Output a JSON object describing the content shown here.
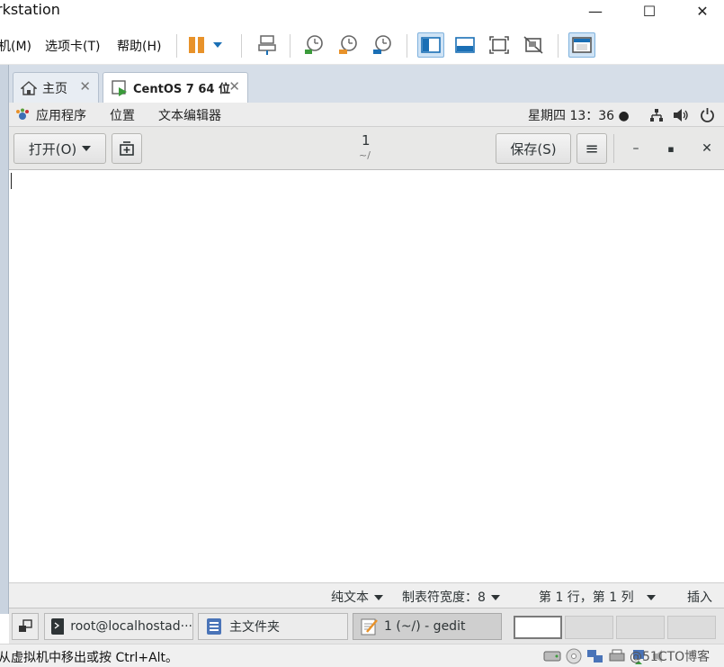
{
  "vmware": {
    "title": "rkstation",
    "menu": [
      "机(M)",
      "选项卡(T)",
      "帮助(H)"
    ],
    "window_controls": [
      "—",
      "☐",
      "✕"
    ],
    "tabs": [
      {
        "label": "主页",
        "close": "✕"
      },
      {
        "label": "CentOS 7 64 位",
        "close": "✕"
      }
    ],
    "status_message": "从虚拟机中移出或按 Ctrl+Alt。",
    "watermark": "@51CTO博客",
    "colors": {
      "accent_blue": "#1a6fb5",
      "pause_orange": "#e8922a"
    }
  },
  "gnome": {
    "applications": "应用程序",
    "places": "位置",
    "current_app": "文本编辑器",
    "clock": "星期四 13：36 ●"
  },
  "gedit": {
    "open_label": "打开(O)",
    "doc_title": "1",
    "doc_path": "~/",
    "save_label": "保存(S)",
    "menu_glyph": "≡",
    "minimize": "–",
    "maximize": "▪",
    "close": "✕",
    "status": {
      "language": "纯文本",
      "tab_width": "制表符宽度：8",
      "position": "第 1 行，第 1 列",
      "mode": "插入"
    }
  },
  "taskbar": {
    "items": [
      {
        "label": "root@localhostad···"
      },
      {
        "label": "主文件夹"
      },
      {
        "label": "1 (~/) - gedit"
      }
    ]
  }
}
